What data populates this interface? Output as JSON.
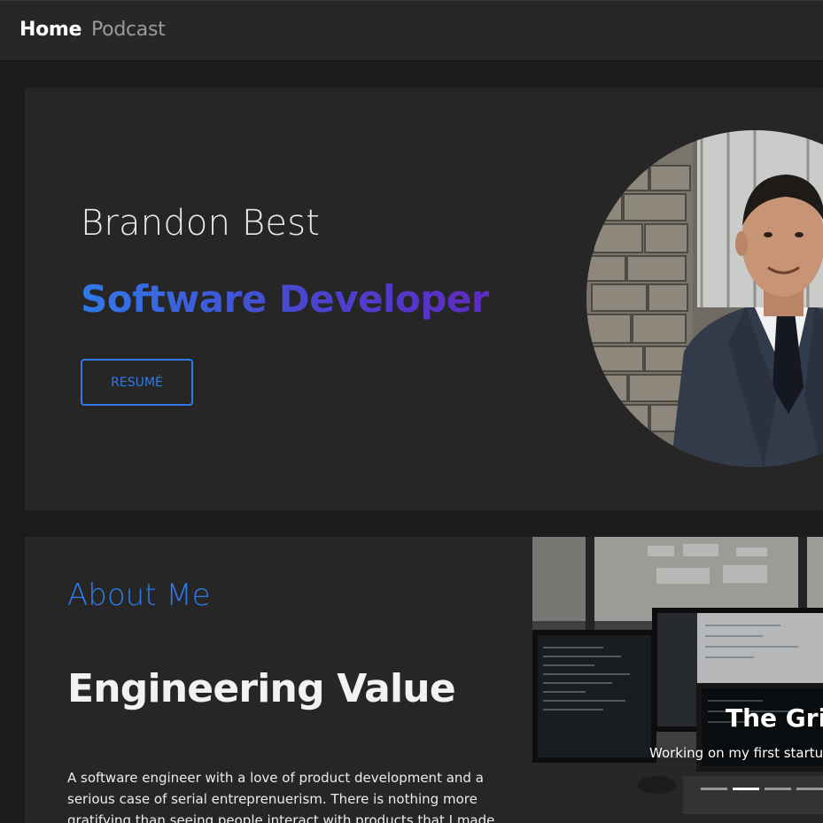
{
  "nav": {
    "home_label": "Home",
    "podcast_label": "Podcast"
  },
  "hero": {
    "name": "Brandon Best",
    "role": "Software Developer",
    "resume_label": "RESUMÉ"
  },
  "about": {
    "heading": "About Me",
    "title": "Engineering Value",
    "text": "A software engineer with a love of product development and a serious case of serial entreprenuerism. There is nothing more gratifying than seeing people interact with products that I made. Trying to uncover the"
  },
  "carousel": {
    "title": "The Grind",
    "caption": "Working on my first startup",
    "active_slide": 2,
    "slide_count": 4
  },
  "colors": {
    "accent": "#2f7ae8",
    "gradient_end": "#5e2bc0",
    "background": "#1b1c1c",
    "panel": "#262626"
  }
}
